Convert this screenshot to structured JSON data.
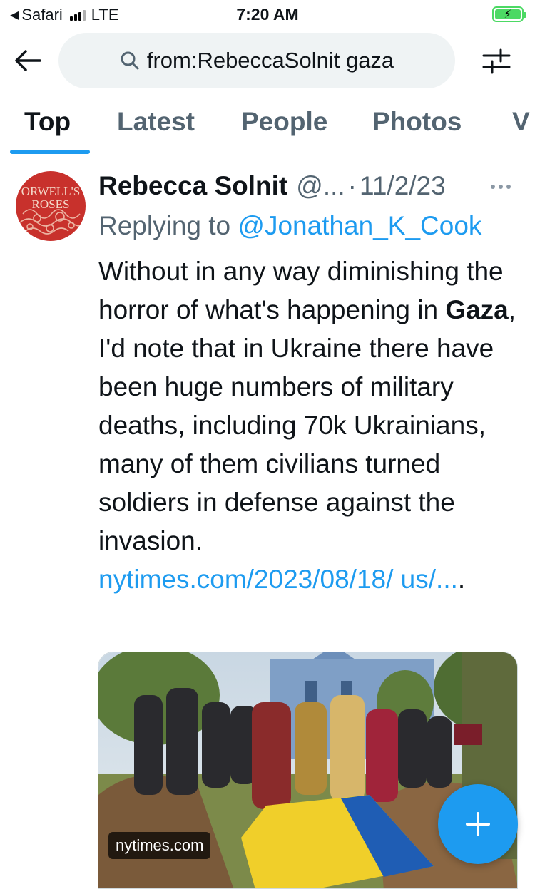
{
  "status_bar": {
    "back_app": "Safari",
    "network": "LTE",
    "time": "7:20 AM",
    "battery_state": "charging"
  },
  "search": {
    "query": "from:RebeccaSolnit gaza",
    "icons": [
      "back-arrow-icon",
      "search-icon",
      "filter-sliders-icon"
    ]
  },
  "tabs": {
    "items": [
      "Top",
      "Latest",
      "People",
      "Photos",
      "V"
    ],
    "active": "Top"
  },
  "tweet": {
    "author_name": "Rebecca Solnit",
    "handle": "@...",
    "separator": "·",
    "date": "11/2/23",
    "replying_prefix": "Replying to ",
    "replying_to": "@Jonathan_K_Cook",
    "avatar_text_line1": "ORWELL'S",
    "avatar_text_line2": "ROSES",
    "text_part1": "Without in any way diminishing the horror of what's happening in ",
    "text_bold": "Gaza",
    "text_part2": ", I'd note that in Ukraine there have been huge numbers of military deaths, including 70k Ukrainians, many of them civilians turned soldiers in defense against the invasion.",
    "link_text": "nytimes.com/2023/08/18/ us/...",
    "link_suffix": ".",
    "media_domain": "nytimes.com"
  },
  "colors": {
    "accent": "#1d9bf0",
    "text_primary": "#0f1419",
    "text_secondary": "#536471",
    "search_bg": "#eff3f4",
    "battery_green": "#4cd964"
  }
}
